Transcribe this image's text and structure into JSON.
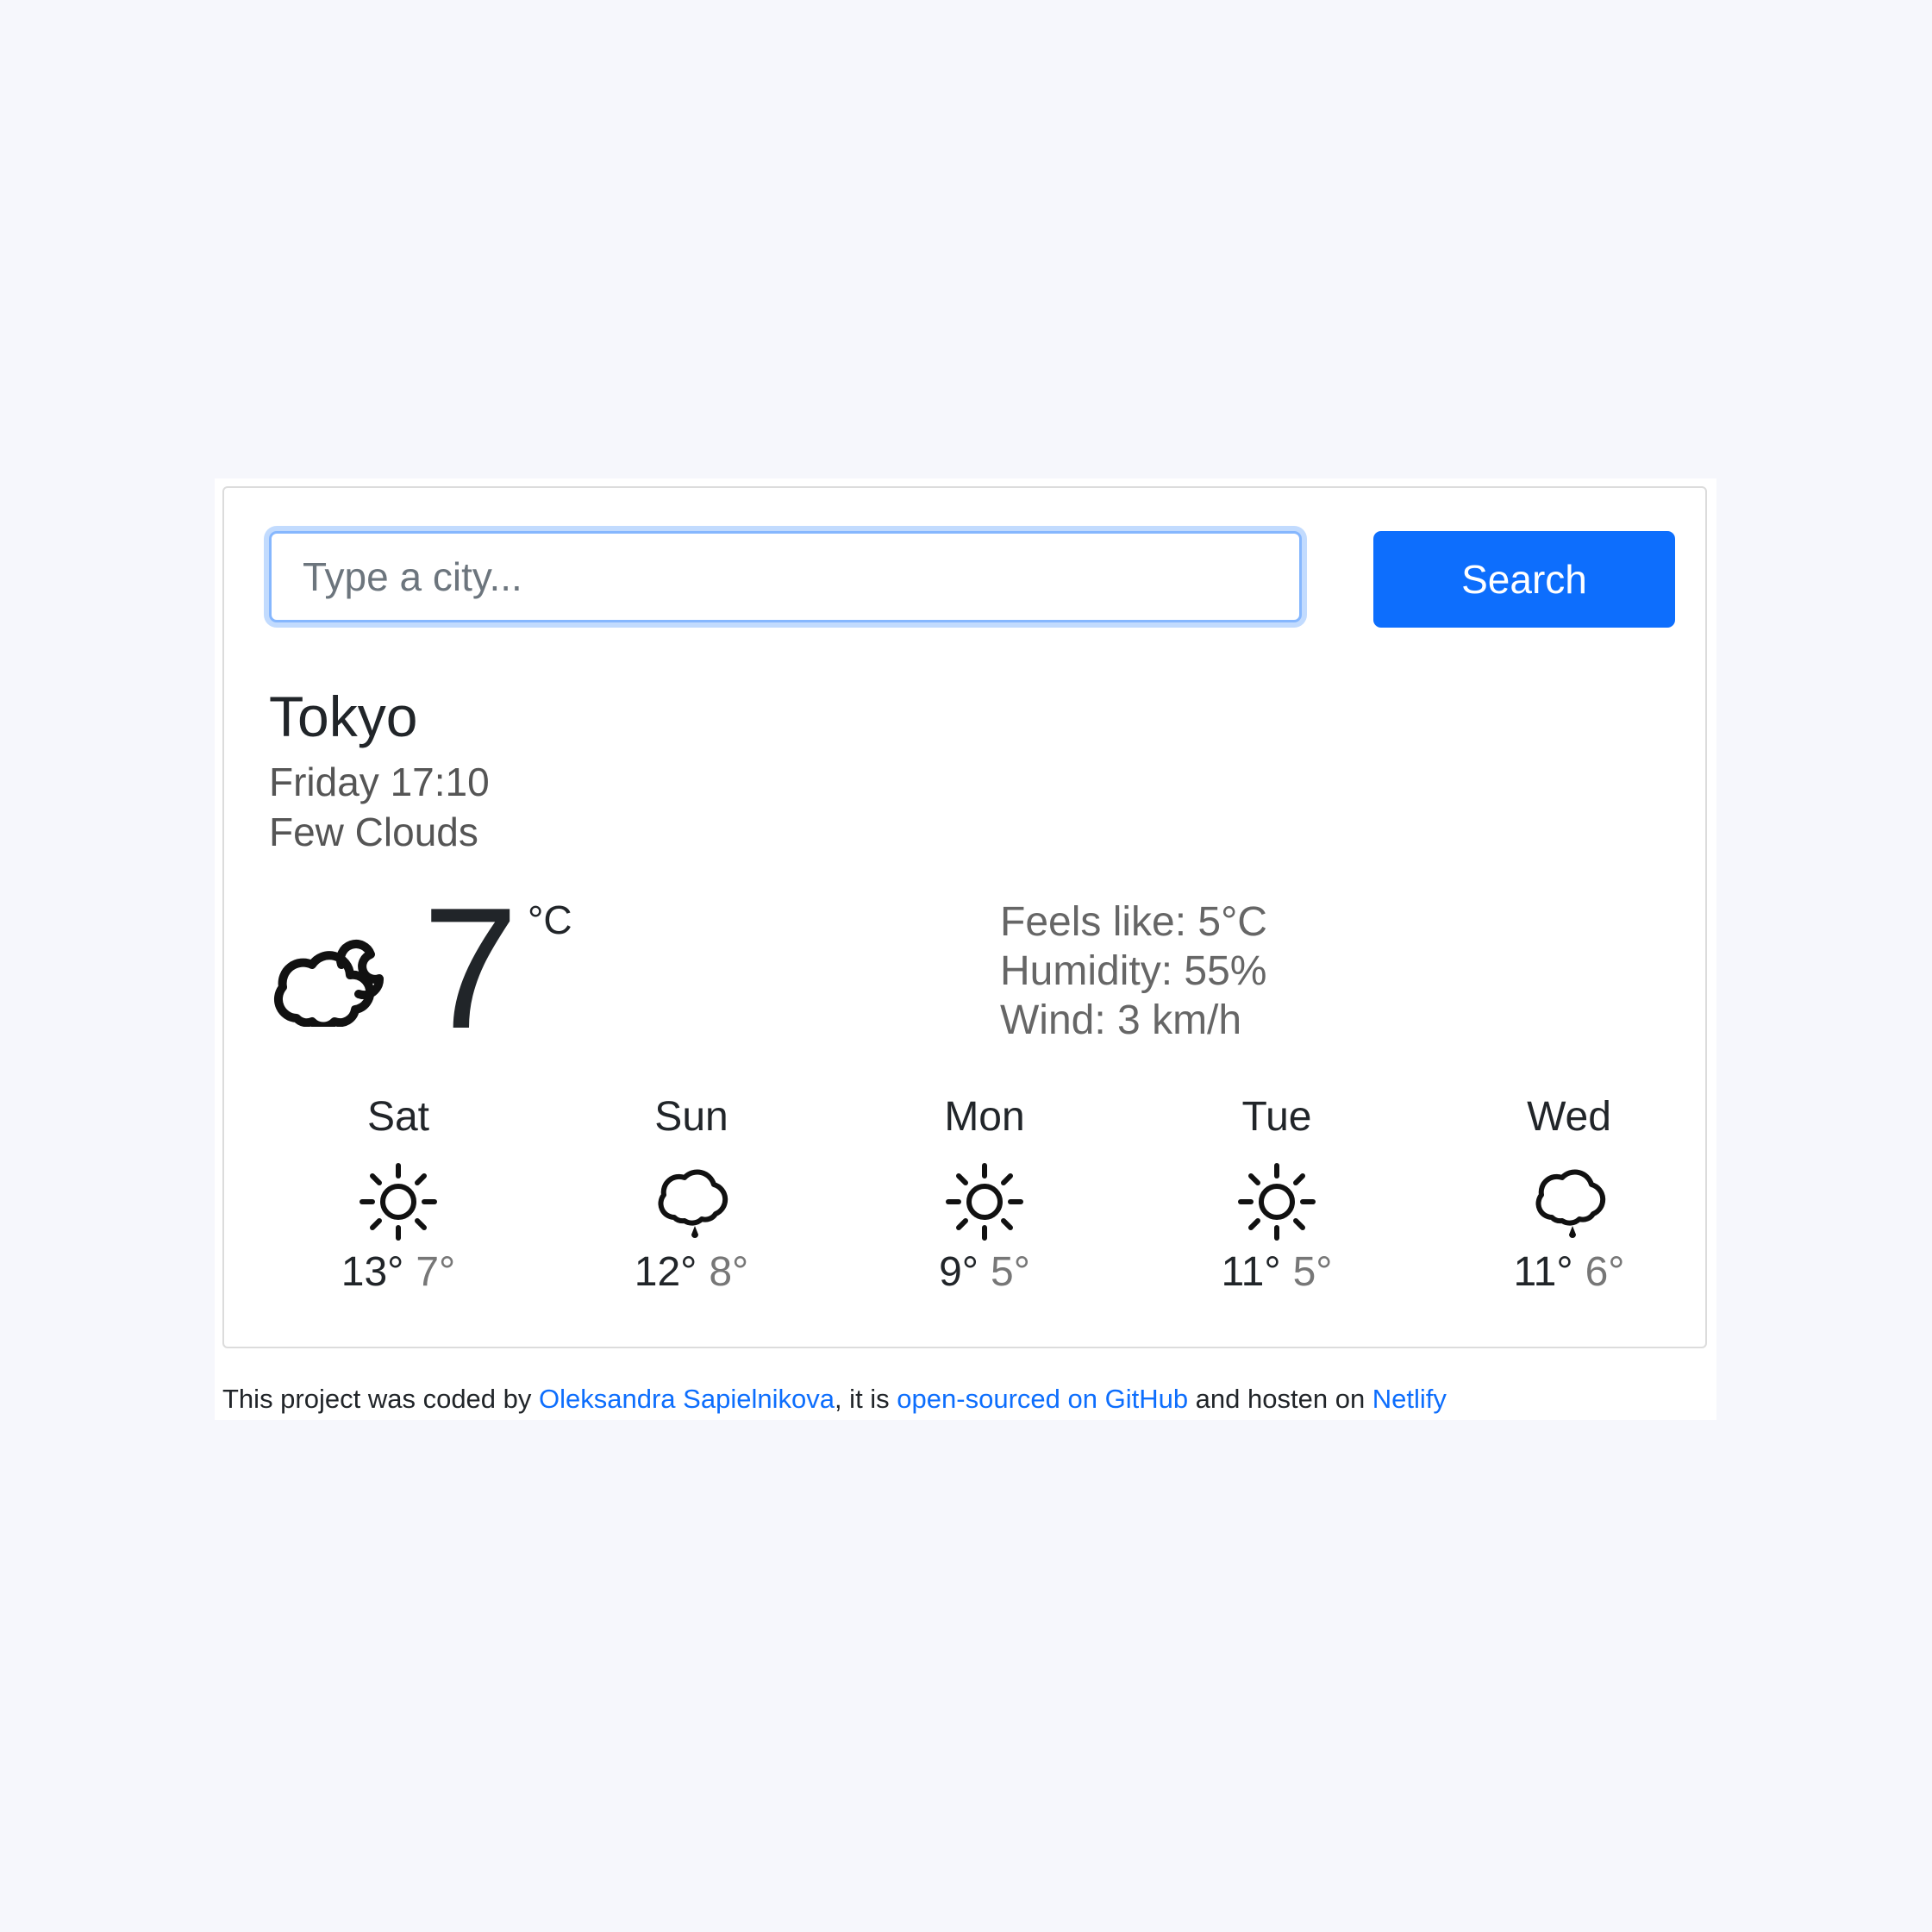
{
  "search": {
    "placeholder": "Type a city...",
    "button_label": "Search"
  },
  "current": {
    "city": "Tokyo",
    "datetime": "Friday 17:10",
    "condition": "Few Clouds",
    "temperature": "7",
    "unit": "°C",
    "icon": "few-clouds-icon",
    "feels_like": "Feels like: 5°C",
    "humidity": "Humidity: 55%",
    "wind": "Wind: 3 km/h"
  },
  "forecast": [
    {
      "day": "Sat",
      "icon": "sun-icon",
      "max": "13°",
      "min": "7°"
    },
    {
      "day": "Sun",
      "icon": "rain-cloud-icon",
      "max": "12°",
      "min": "8°"
    },
    {
      "day": "Mon",
      "icon": "sun-icon",
      "max": "9°",
      "min": "5°"
    },
    {
      "day": "Tue",
      "icon": "sun-icon",
      "max": "11°",
      "min": "5°"
    },
    {
      "day": "Wed",
      "icon": "rain-cloud-icon",
      "max": "11°",
      "min": "6°"
    }
  ],
  "footer": {
    "prefix": "This project was coded by ",
    "author_link": "Oleksandra Sapielnikova",
    "middle": ", it is ",
    "github_link": "open-sourced on GitHub",
    "middle2": " and hosten on ",
    "netlify_link": "Netlify"
  },
  "colors": {
    "accent": "#0d6efd",
    "page_background": "#f6f7fc"
  }
}
